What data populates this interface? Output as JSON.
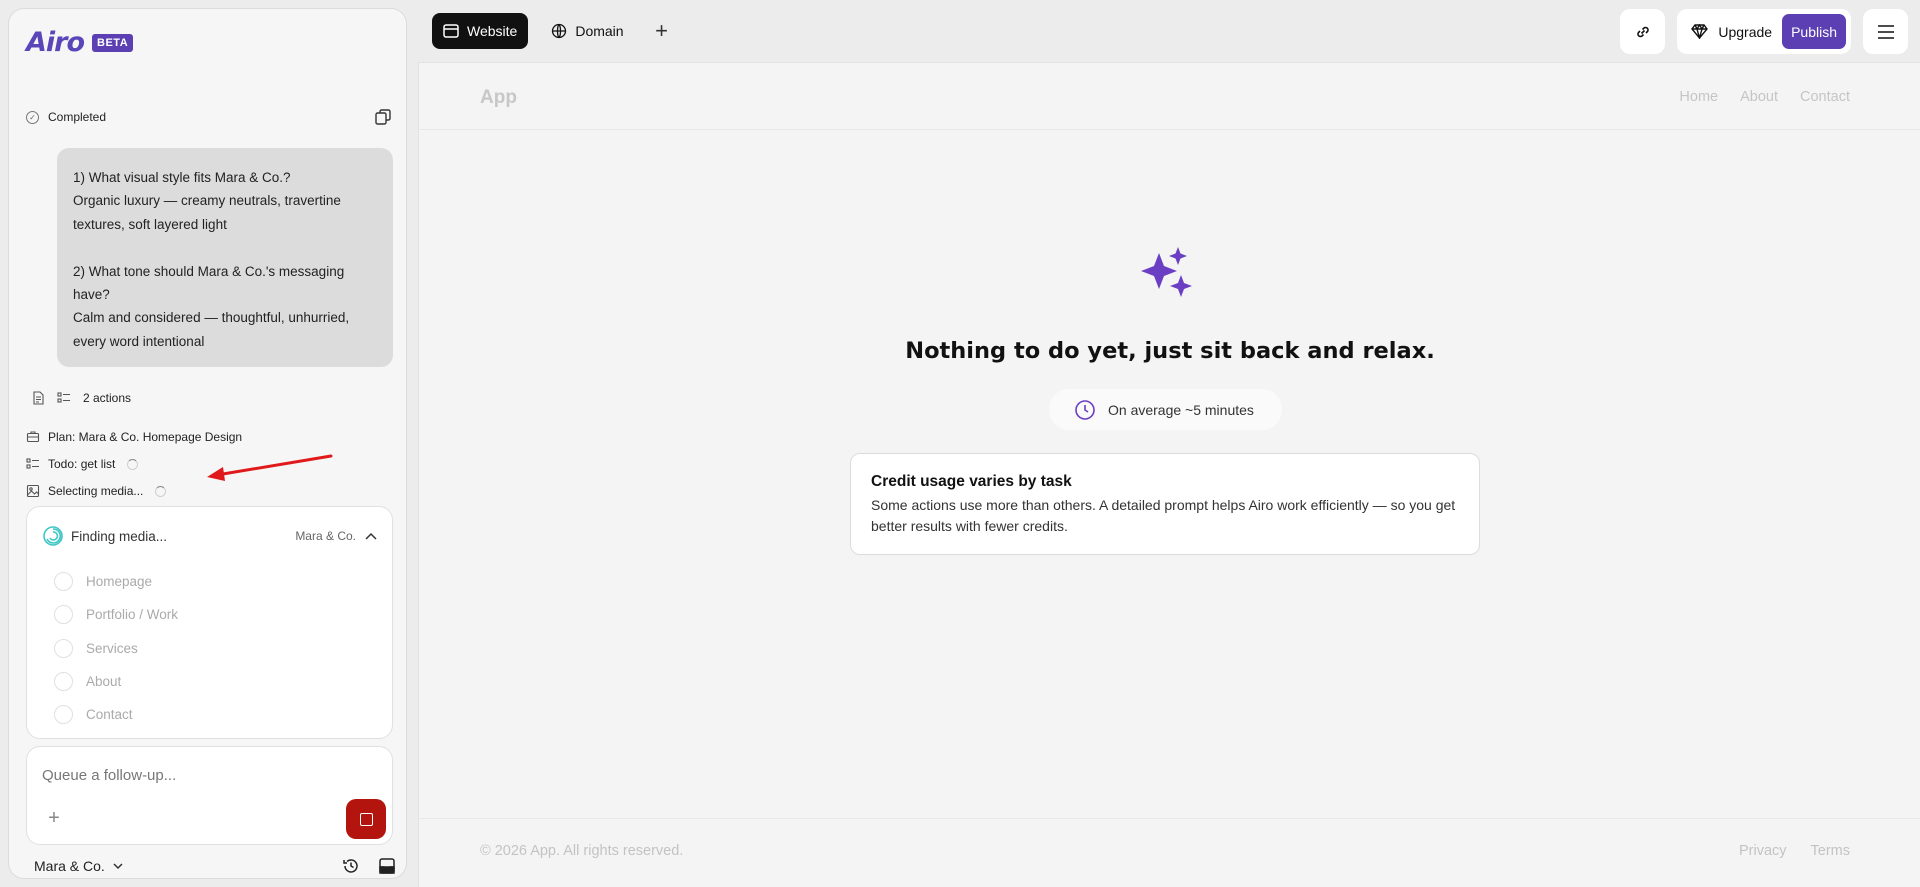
{
  "brand": {
    "name": "Airo",
    "badge": "BETA"
  },
  "status": {
    "label": "Completed"
  },
  "message": {
    "text": "1) What visual style fits Mara & Co.?\nOrganic luxury — creamy neutrals, travertine textures, soft layered light\n\n2) What tone should Mara & Co.'s messaging have?\nCalm and considered — thoughtful, unhurried, every word intentional"
  },
  "actions": {
    "label": "2 actions"
  },
  "tasks": [
    {
      "label": "Plan: Mara & Co. Homepage Design",
      "icon": "plan-icon"
    },
    {
      "label": "Todo: get list",
      "icon": "todo-icon"
    },
    {
      "label": "Selecting media...",
      "icon": "image-icon"
    }
  ],
  "media": {
    "title": "Finding media...",
    "project": "Mara & Co.",
    "items": [
      "Homepage",
      "Portfolio / Work",
      "Services",
      "About",
      "Contact"
    ]
  },
  "composer": {
    "placeholder": "Queue a follow-up..."
  },
  "project": {
    "name": "Mara & Co."
  },
  "topbar": {
    "tabs": [
      {
        "label": "Website",
        "icon": "browser-icon"
      },
      {
        "label": "Domain",
        "icon": "globe-icon"
      }
    ],
    "upgrade": "Upgrade",
    "publish": "Publish"
  },
  "preview": {
    "site_title": "App",
    "nav": [
      "Home",
      "About",
      "Contact"
    ],
    "headline": "Nothing to do yet, just sit back and relax.",
    "avg": "On average ~5 minutes",
    "credit_title": "Credit usage varies by task",
    "credit_body": "Some actions use more than others. A detailed prompt helps Airo work efficiently — so you get better results with fewer credits.",
    "copyright": "© 2026 App. All rights reserved.",
    "legal": [
      "Privacy",
      "Terms"
    ]
  },
  "colors": {
    "accent": "#5b3fb3",
    "stop": "#b3150e",
    "arrow": "#e0191a"
  }
}
